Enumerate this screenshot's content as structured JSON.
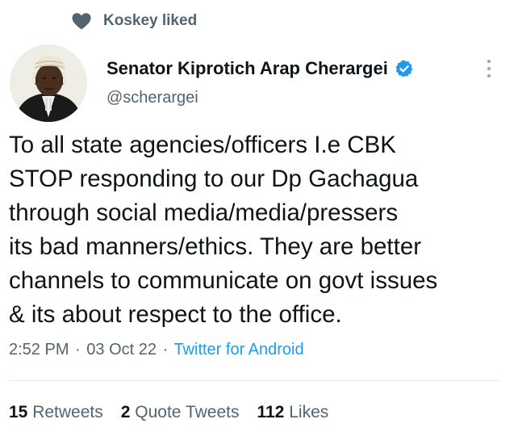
{
  "social_context": {
    "icon": "heart-icon",
    "text": "Koskey liked"
  },
  "author": {
    "display_name": "Senator Kiprotich Arap Cherargei",
    "handle": "@scherargei",
    "verified": true,
    "verified_color": "#1d9bf0"
  },
  "tweet": {
    "lines": [
      "To all state agencies/officers I.e CBK",
      "STOP responding to our Dp Gachagua",
      "through social media/media/pressers",
      "its bad manners/ethics. They are better",
      "channels to communicate on govt issues",
      "& its about respect to the office."
    ]
  },
  "meta": {
    "time": "2:52 PM",
    "separator": "·",
    "date": "03 Oct 22",
    "source": "Twitter for Android"
  },
  "stats": {
    "retweets_count": "15",
    "retweets_label": "Retweets",
    "quotes_count": "2",
    "quotes_label": "Quote Tweets",
    "likes_count": "112",
    "likes_label": "Likes"
  },
  "colors": {
    "text_primary": "#0f1419",
    "text_secondary": "#536471",
    "link": "#1d9bf0",
    "divider": "#e6ecf0"
  }
}
